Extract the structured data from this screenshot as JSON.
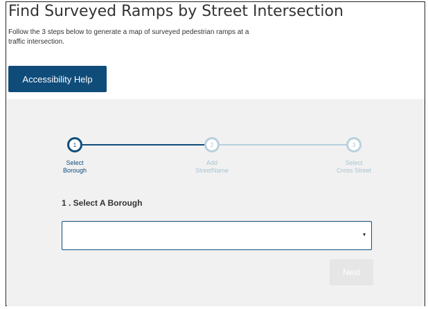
{
  "header": {
    "title": "Find Surveyed Ramps by Street Intersection",
    "subtitle": "Follow the 3 steps below to generate a map of surveyed pedestrian ramps at a traffic intersection."
  },
  "help_button": {
    "label": "Accessibility Help"
  },
  "stepper": {
    "steps": [
      {
        "number": "1",
        "line1": "Select",
        "line2": "Borough",
        "state": "active"
      },
      {
        "number": "2",
        "line1": "Add",
        "line2": "StreetName",
        "state": "inactive"
      },
      {
        "number": "3",
        "line1": "Select",
        "line2": "Cross Street",
        "state": "inactive"
      }
    ]
  },
  "form": {
    "heading": "1 . Select A Borough",
    "select_value": "",
    "select_arrow": "▾",
    "next_label": "Next"
  },
  "colors": {
    "accent": "#0f4c7a",
    "inactive_step": "#b7d0dd",
    "panel_bg": "#f1f1f1",
    "disabled_button": "#e6e6e6"
  }
}
